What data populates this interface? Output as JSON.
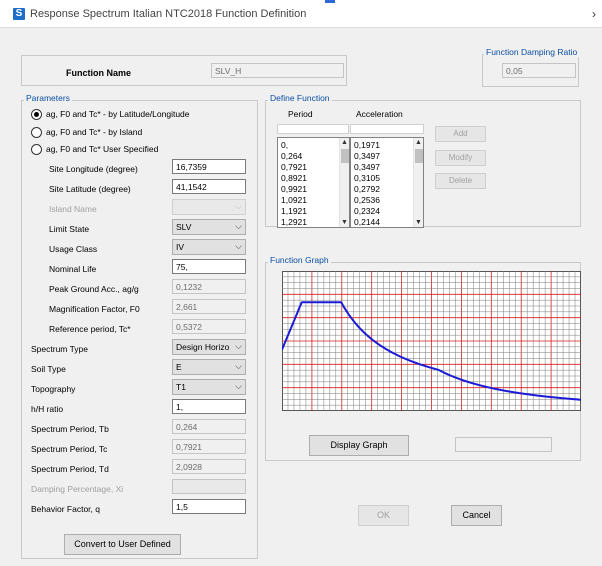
{
  "window": {
    "title": "Response Spectrum Italian NTC2018 Function Definition",
    "icon": "S",
    "close": "›"
  },
  "function_name": {
    "label": "Function Name",
    "value": "SLV_H"
  },
  "damping": {
    "title": "Function Damping Ratio",
    "value": "0,05"
  },
  "parameters": {
    "title": "Parameters",
    "radios": [
      {
        "label": "ag, F0 and Tc* - by Latitude/Longitude",
        "selected": true
      },
      {
        "label": "ag, F0 and Tc* - by Island",
        "selected": false
      },
      {
        "label": "ag, F0 and Tc* User Specified",
        "selected": false
      }
    ],
    "site_longitude": {
      "label": "Site Longitude (degree)",
      "value": "16,7359"
    },
    "site_latitude": {
      "label": "Site Latitude (degree)",
      "value": "41,1542"
    },
    "island_name": {
      "label": "Island Name",
      "value": ""
    },
    "limit_state": {
      "label": "Limit State",
      "value": "SLV"
    },
    "usage_class": {
      "label": "Usage Class",
      "value": "IV"
    },
    "nominal_life": {
      "label": "Nominal Life",
      "value": "75,"
    },
    "peak_ground_acc": {
      "label": "Peak Ground Acc., ag/g",
      "value": "0,1232"
    },
    "magnification_factor": {
      "label": "Magnification Factor, F0",
      "value": "2,661"
    },
    "reference_period": {
      "label": "Reference period, Tc*",
      "value": "0,5372"
    },
    "spectrum_type": {
      "label": "Spectrum Type",
      "value": "Design Horizo"
    },
    "soil_type": {
      "label": "Soil Type",
      "value": "E"
    },
    "topography": {
      "label": "Topography",
      "value": "T1"
    },
    "hh_ratio": {
      "label": "h/H ratio",
      "value": "1,"
    },
    "spectrum_tb": {
      "label": "Spectrum Period, Tb",
      "value": "0,264"
    },
    "spectrum_tc": {
      "label": "Spectrum Period, Tc",
      "value": "0,7921"
    },
    "spectrum_td": {
      "label": "Spectrum Period, Td",
      "value": "2,0928"
    },
    "damping_percentage": {
      "label": "Damping Percentage, Xi",
      "value": ""
    },
    "behavior_factor": {
      "label": "Behavior Factor, q",
      "value": "1,5"
    },
    "convert_button": "Convert to User Defined"
  },
  "define_function": {
    "title": "Define Function",
    "period_header": "Period",
    "acceleration_header": "Acceleration",
    "periods": [
      "0,",
      "0,264",
      "0,7921",
      "0,8921",
      "0,9921",
      "1,0921",
      "1,1921",
      "1,2921"
    ],
    "accelerations": [
      "0,1971",
      "0,3497",
      "0,3497",
      "0,3105",
      "0,2792",
      "0,2536",
      "0,2324",
      "0,2144"
    ],
    "add_button": "Add",
    "modify_button": "Modify",
    "delete_button": "Delete"
  },
  "function_graph": {
    "title": "Function Graph",
    "display_button": "Display Graph",
    "curve_color": "#1a1ad8",
    "minor_grid_color": "#7a7a7a",
    "major_grid_color": "#d81e1e"
  },
  "footer": {
    "ok_button": "OK",
    "cancel_button": "Cancel"
  }
}
